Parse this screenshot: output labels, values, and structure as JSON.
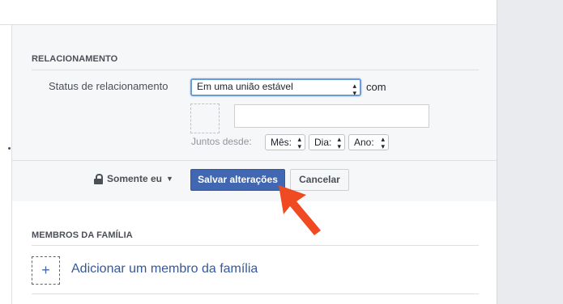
{
  "relationship": {
    "section_title": "RELACIONAMENTO",
    "status_label": "Status de relacionamento",
    "status_value": "Em uma união estável",
    "with_text": "com",
    "partner_value": "",
    "together_since_label": "Juntos desde:",
    "month_select": "Mês:",
    "day_select": "Dia:",
    "year_select": "Ano:"
  },
  "actions": {
    "privacy_label": "Somente eu",
    "save_label": "Salvar alterações",
    "cancel_label": "Cancelar"
  },
  "family": {
    "section_title": "MEMBROS DA FAMÍLIA",
    "add_icon": "+",
    "add_label": "Adicionar um membro da família"
  },
  "colors": {
    "accent": "#4267b2",
    "annotation_arrow": "#f04a23"
  }
}
